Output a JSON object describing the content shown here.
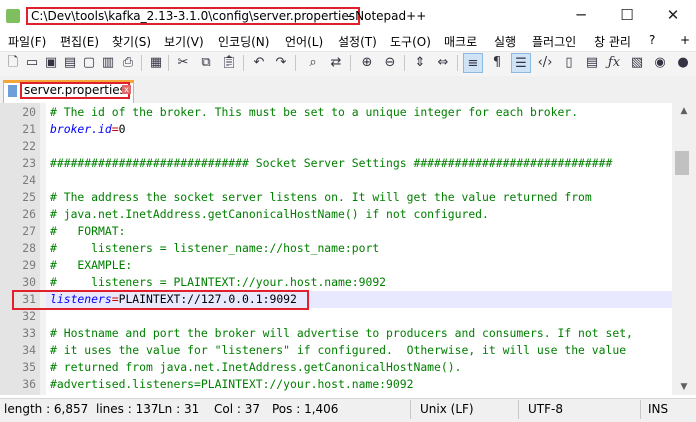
{
  "window": {
    "title_path": "C:\\Dev\\tools\\kafka_2.13-3.1.0\\config\\server.properties",
    "title_app": "- Notepad++",
    "minimize": "─",
    "maximize": "☐",
    "close": "✕"
  },
  "menu": [
    "파일(F)",
    "편집(E)",
    "찾기(S)",
    "보기(V)",
    "인코딩(N)",
    "언어(L)",
    "설정(T)",
    "도구(O)",
    "매크로",
    "실행",
    "플러그인",
    "창 관리",
    "?",
    "+",
    "▼",
    "✕"
  ],
  "toolbar": {
    "icons": [
      "new-file-icon",
      "open-file-icon",
      "save-icon",
      "save-all-icon",
      "close-icon",
      "close-all-icon",
      "print-icon",
      "cut-icon",
      "copy-icon",
      "paste-icon",
      "undo-icon",
      "redo-icon",
      "find-icon",
      "replace-icon",
      "zoom-in-icon",
      "zoom-out-icon",
      "sync-vertical-icon",
      "sync-horizontal-icon",
      "word-wrap-icon",
      "show-all-chars-icon",
      "indent-guide-icon",
      "xml-icon",
      "map-icon",
      "function-list-icon",
      "folder-as-workspace-icon",
      "monitoring-icon"
    ]
  },
  "tab": {
    "label": "server.properties",
    "close": "x"
  },
  "editor": {
    "lines": [
      {
        "n": "20",
        "segments": [
          {
            "t": "# The id of the broker. This must be set to a unique integer for each broker.",
            "cls": "c"
          }
        ]
      },
      {
        "n": "21",
        "segments": [
          {
            "t": "broker.id",
            "cls": "k"
          },
          {
            "t": "=",
            "cls": "o"
          },
          {
            "t": "0",
            "cls": "v"
          }
        ]
      },
      {
        "n": "22",
        "segments": []
      },
      {
        "n": "23",
        "segments": [
          {
            "t": "############################# Socket Server Settings #############################",
            "cls": "c"
          }
        ]
      },
      {
        "n": "24",
        "segments": []
      },
      {
        "n": "25",
        "segments": [
          {
            "t": "# The address the socket server listens on. It will get the value returned from",
            "cls": "c"
          }
        ]
      },
      {
        "n": "26",
        "segments": [
          {
            "t": "# java.net.InetAddress.getCanonicalHostName() if not configured.",
            "cls": "c"
          }
        ]
      },
      {
        "n": "27",
        "segments": [
          {
            "t": "#   FORMAT:",
            "cls": "c"
          }
        ]
      },
      {
        "n": "28",
        "segments": [
          {
            "t": "#     listeners = listener_name://host_name:port",
            "cls": "c"
          }
        ]
      },
      {
        "n": "29",
        "segments": [
          {
            "t": "#   EXAMPLE:",
            "cls": "c"
          }
        ]
      },
      {
        "n": "30",
        "segments": [
          {
            "t": "#     listeners = PLAINTEXT://your.host.name:9092",
            "cls": "c"
          }
        ]
      },
      {
        "n": "31",
        "segments": [
          {
            "t": "listeners",
            "cls": "k"
          },
          {
            "t": "=",
            "cls": "o"
          },
          {
            "t": "PLAINTEXT://127.0.0.1:9092",
            "cls": "v"
          }
        ]
      },
      {
        "n": "32",
        "segments": []
      },
      {
        "n": "33",
        "segments": [
          {
            "t": "# Hostname and port the broker will advertise to producers and consumers. If not set,",
            "cls": "c"
          }
        ]
      },
      {
        "n": "34",
        "segments": [
          {
            "t": "# it uses the value for \"listeners\" if configured.  Otherwise, it will use the value",
            "cls": "c"
          }
        ]
      },
      {
        "n": "35",
        "segments": [
          {
            "t": "# returned from java.net.InetAddress.getCanonicalHostName().",
            "cls": "c"
          }
        ]
      },
      {
        "n": "36",
        "segments": [
          {
            "t": "#advertised.listeners=PLAINTEXT://your.host.name:9092",
            "cls": "c"
          }
        ]
      }
    ],
    "current_line": "31"
  },
  "statusbar": {
    "length": "length : 6,857",
    "lines": "lines : 137",
    "ln": "Ln : 31",
    "col": "Col : 37",
    "pos": "Pos : 1,406",
    "eol": "Unix (LF)",
    "encoding": "UTF-8",
    "mode": "INS"
  }
}
